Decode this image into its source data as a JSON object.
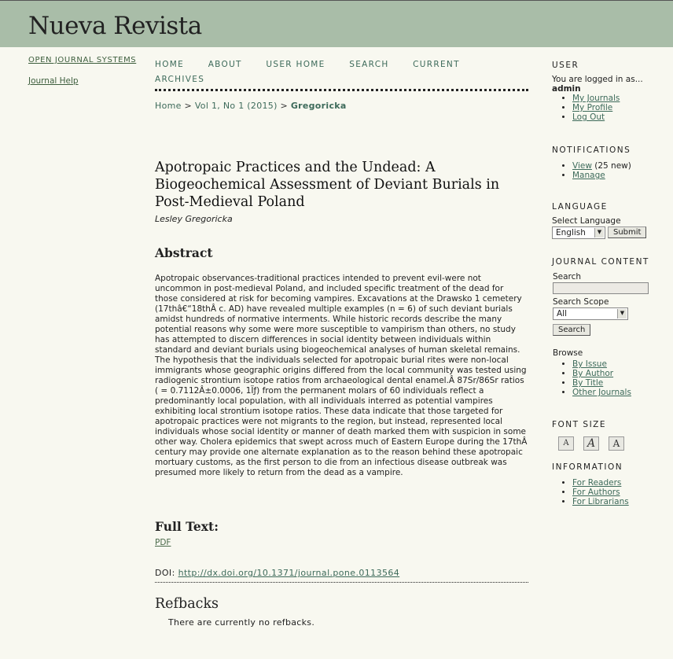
{
  "site": {
    "title": "Nueva Revista"
  },
  "left": {
    "ojs": "OPEN JOURNAL SYSTEMS",
    "help": "Journal Help"
  },
  "nav": {
    "home": "HOME",
    "about": "ABOUT",
    "user_home": "USER HOME",
    "search": "SEARCH",
    "current": "CURRENT",
    "archives": "ARCHIVES"
  },
  "breadcrumb": {
    "home": "Home",
    "sep1": " > ",
    "issue": "Vol 1, No 1 (2015)",
    "sep2": " > ",
    "current": "Gregoricka"
  },
  "article": {
    "title": "Apotropaic Practices and the Undead: A Biogeochemical Assessment of Deviant Burials in Post-Medieval Poland",
    "author": "Lesley Gregoricka",
    "abstract_heading": "Abstract",
    "abstract": "Apotropaic observances-traditional practices intended to prevent evil-were not uncommon in post-medieval Poland, and included specific treatment of the dead for those considered at risk for becoming vampires. Excavations at the Drawsko 1 cemetery (17thâ€“18thÂ c. AD) have revealed multiple examples (n = 6) of such deviant burials amidst hundreds of normative interments. While historic records describe the many potential reasons why some were more susceptible to vampirism than others, no study has attempted to discern differences in social identity between individuals within standard and deviant burials using biogeochemical analyses of human skeletal remains. The hypothesis that the individuals selected for apotropaic burial rites were non-local immigrants whose geographic origins differed from the local community was tested using radiogenic strontium isotope ratios from archaeological dental enamel.Â 87Sr/86Sr ratios ( = 0.7112Â±0.0006, 1Ïƒ) from the permanent molars of 60 individuals reflect a predominantly local population, with all individuals interred as potential vampires exhibiting local strontium isotope ratios. These data indicate that those targeted for apotropaic practices were not migrants to the region, but instead, represented local individuals whose social identity or manner of death marked them with suspicion in some other way. Cholera epidemics that swept across much of Eastern Europe during the 17thÂ century may provide one alternate explanation as to the reason behind these apotropaic mortuary customs, as the first person to die from an infectious disease outbreak was presumed more likely to return from the dead as a vampire.",
    "fulltext_heading": "Full Text:",
    "pdf": "PDF",
    "doi_label": "DOI: ",
    "doi_link": "http://dx.doi.org/10.1371/journal.pone.0113564",
    "refbacks_heading": "Refbacks",
    "no_refbacks": "There are currently no refbacks."
  },
  "sidebar": {
    "user": {
      "title": "USER",
      "logged_in": "You are logged in as...",
      "username": "admin",
      "links": [
        "My Journals",
        "My Profile",
        "Log Out"
      ]
    },
    "notifications": {
      "title": "NOTIFICATIONS",
      "view": "View",
      "view_count": " (25 new)",
      "manage": "Manage"
    },
    "language": {
      "title": "LANGUAGE",
      "label": "Select Language",
      "selected": "English",
      "submit": "Submit"
    },
    "journal_content": {
      "title": "JOURNAL CONTENT",
      "search_label": "Search",
      "search_value": "",
      "scope_label": "Search Scope",
      "scope_selected": "All",
      "search_button": "Search",
      "browse_label": "Browse",
      "browse_links": [
        "By Issue",
        "By Author",
        "By Title",
        "Other Journals"
      ]
    },
    "font_size": {
      "title": "FONT SIZE",
      "small": "A",
      "medium": "A",
      "large": "A"
    },
    "information": {
      "title": "INFORMATION",
      "links": [
        "For Readers",
        "For Authors",
        "For Librarians"
      ]
    }
  }
}
